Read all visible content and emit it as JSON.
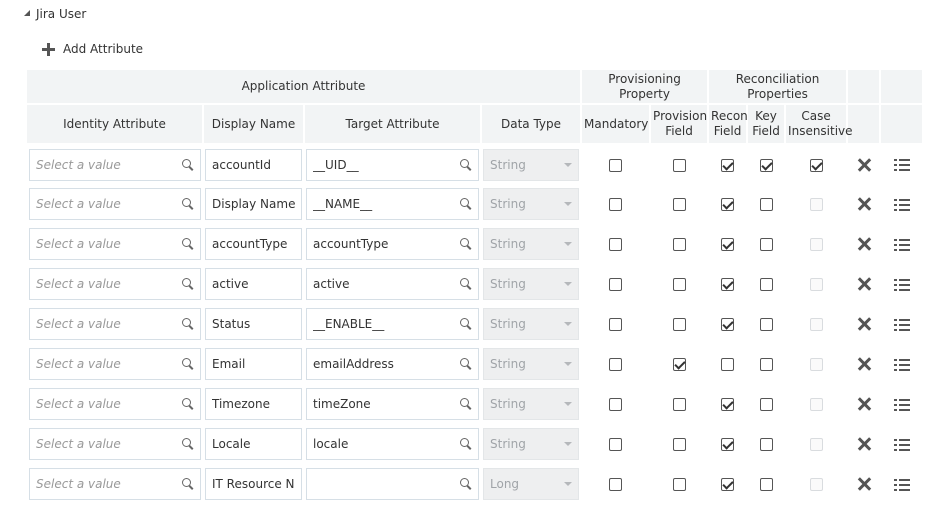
{
  "section": {
    "title": "Jira User"
  },
  "toolbar": {
    "add_label": "Add Attribute"
  },
  "columns": {
    "group_app": "Application Attribute",
    "group_prov": "Provisioning Property",
    "group_recon": "Reconciliation Properties",
    "identity": "Identity Attribute",
    "display_name": "Display Name",
    "target": "Target Attribute",
    "data_type": "Data Type",
    "mandatory": "Mandatory",
    "provision_field": "Provision Field",
    "recon_field": "Recon Field",
    "key_field": "Key Field",
    "case_insensitive": "Case Insensitive"
  },
  "placeholder": "Select a value",
  "rows": [
    {
      "identity": "",
      "display_name": "accountId",
      "target": "__UID__",
      "data_type": "String",
      "mandatory": false,
      "provision_field": false,
      "recon_field": true,
      "key_field": true,
      "case_insensitive": true,
      "case_enabled": true
    },
    {
      "identity": "",
      "display_name": "Display Name",
      "target": "__NAME__",
      "data_type": "String",
      "mandatory": false,
      "provision_field": false,
      "recon_field": true,
      "key_field": false,
      "case_insensitive": false,
      "case_enabled": false
    },
    {
      "identity": "",
      "display_name": "accountType",
      "target": "accountType",
      "data_type": "String",
      "mandatory": false,
      "provision_field": false,
      "recon_field": true,
      "key_field": false,
      "case_insensitive": false,
      "case_enabled": false
    },
    {
      "identity": "",
      "display_name": "active",
      "target": "active",
      "data_type": "String",
      "mandatory": false,
      "provision_field": false,
      "recon_field": true,
      "key_field": false,
      "case_insensitive": false,
      "case_enabled": false
    },
    {
      "identity": "",
      "display_name": "Status",
      "target": "__ENABLE__",
      "data_type": "String",
      "mandatory": false,
      "provision_field": false,
      "recon_field": true,
      "key_field": false,
      "case_insensitive": false,
      "case_enabled": false
    },
    {
      "identity": "",
      "display_name": "Email",
      "target": "emailAddress",
      "data_type": "String",
      "mandatory": false,
      "provision_field": true,
      "recon_field": false,
      "key_field": false,
      "case_insensitive": false,
      "case_enabled": false
    },
    {
      "identity": "",
      "display_name": "Timezone",
      "target": "timeZone",
      "data_type": "String",
      "mandatory": false,
      "provision_field": false,
      "recon_field": true,
      "key_field": false,
      "case_insensitive": false,
      "case_enabled": false
    },
    {
      "identity": "",
      "display_name": "Locale",
      "target": "locale",
      "data_type": "String",
      "mandatory": false,
      "provision_field": false,
      "recon_field": true,
      "key_field": false,
      "case_insensitive": false,
      "case_enabled": false
    },
    {
      "identity": "",
      "display_name": "IT Resource Nar",
      "target": "",
      "data_type": "Long",
      "mandatory": false,
      "provision_field": false,
      "recon_field": true,
      "key_field": false,
      "case_insensitive": false,
      "case_enabled": false
    }
  ],
  "icons": {
    "section_toggle": "collapse-triangle-icon",
    "add": "plus-icon",
    "search": "search-icon",
    "dropdown": "chevron-down-icon",
    "delete": "delete-x-icon",
    "details": "list-details-icon"
  },
  "colors": {
    "header_bg": "#f2f4f5",
    "border": "#d6dfe6",
    "disabled_bg": "#eeeff0",
    "icon": "#555555"
  }
}
